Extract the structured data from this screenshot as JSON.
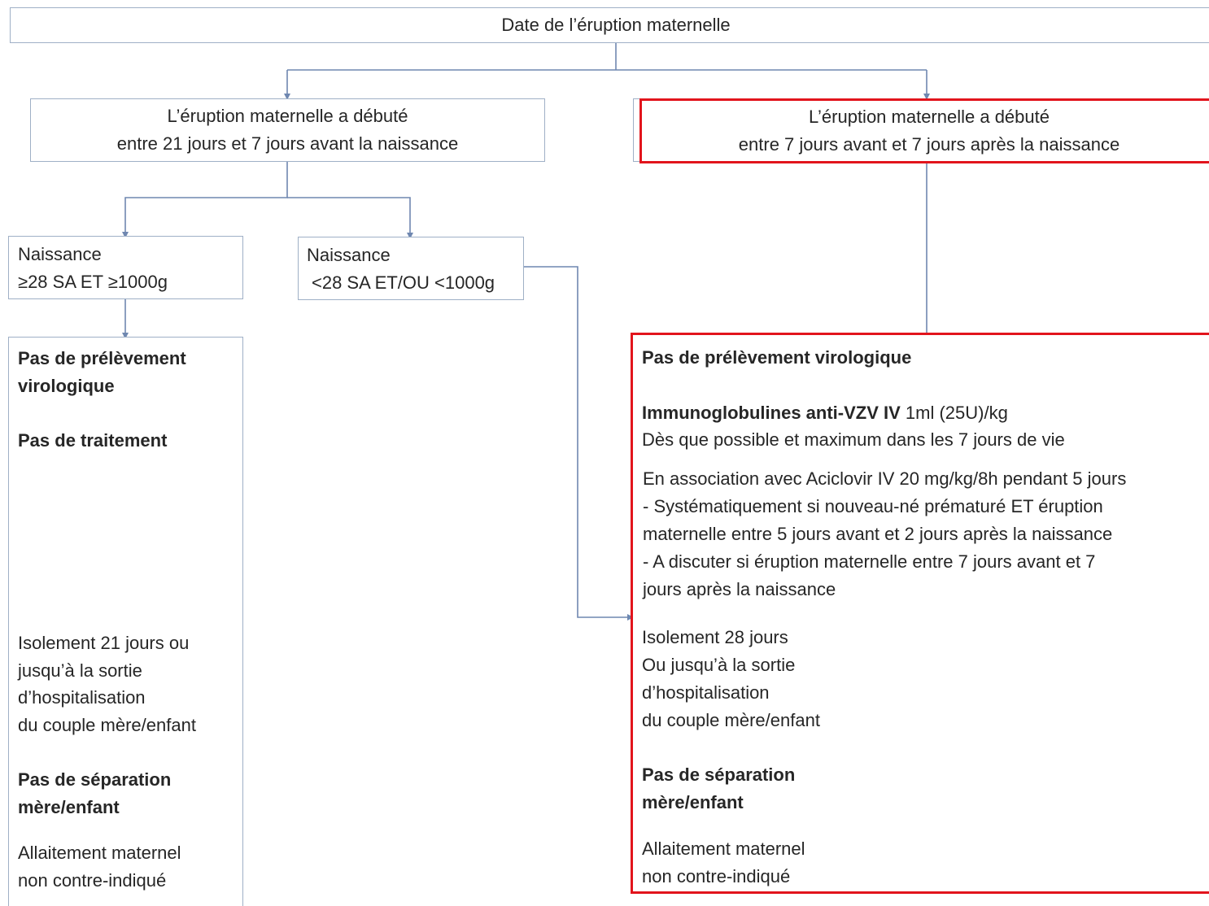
{
  "top": {
    "title": "Date de l’éruption maternelle"
  },
  "branch_left": {
    "line1": "L’éruption maternelle a débuté",
    "line2": "entre 21 jours et 7 jours avant la naissance"
  },
  "branch_right": {
    "line1": "L’éruption maternelle a débuté",
    "line2": "entre 7 jours avant et 7 jours après la naissance"
  },
  "birth_term": {
    "line1": "Naissance",
    "line2": "≥28 SA ET ≥1000g"
  },
  "birth_preterm": {
    "line1": "Naissance",
    "line2": "<28 SA ET/OU <1000g"
  },
  "left_result": {
    "no_sample_1": "Pas de prélèvement",
    "no_sample_2": "virologique",
    "no_treatment": "Pas de traitement",
    "isolation_1": "Isolement 21 jours ou",
    "isolation_2": "jusqu’à la sortie",
    "isolation_3": "d’hospitalisation",
    "isolation_4": "du couple mère/enfant",
    "no_separation_1": "Pas de séparation",
    "no_separation_2": "mère/enfant",
    "breastfeeding_1": "Allaitement maternel",
    "breastfeeding_2": "non contre-indiqué"
  },
  "right_result": {
    "no_sample": "Pas de prélèvement virologique",
    "ig_bold": "Immunoglobulines anti-VZV IV",
    "ig_dose": " 1ml (25U)/kg",
    "ig_timing": "Dès que possible et maximum dans les 7 jours de vie",
    "aciclovir": "En association avec Aciclovir IV 20 mg/kg/8h pendant 5 jours",
    "sys_1": "- Systématiquement si nouveau-né prématuré ET éruption",
    "sys_2": "maternelle entre 5 jours avant et 2 jours après la naissance",
    "disc_1": "- A discuter si éruption maternelle entre 7 jours avant et 7",
    "disc_2": "jours après la naissance",
    "isolation_1": "Isolement 28 jours",
    "isolation_2": "Ou jusqu’à la sortie",
    "isolation_3": "d’hospitalisation",
    "isolation_4": "du couple mère/enfant",
    "no_separation_1": "Pas de séparation",
    "no_separation_2": "mère/enfant",
    "breastfeeding_1": "Allaitement maternel",
    "breastfeeding_2": "non contre-indiqué"
  },
  "colors": {
    "box_border": "#9fb0c6",
    "connector": "#6f87b0",
    "highlight": "#e2141c"
  }
}
